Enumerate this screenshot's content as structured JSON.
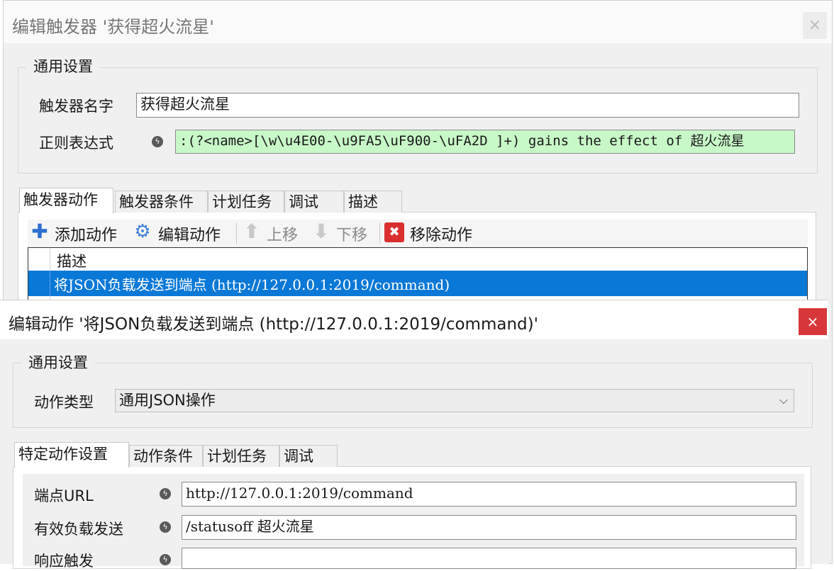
{
  "trigger_window": {
    "title": "编辑触发器 '获得超火流星'",
    "close_glyph": "×",
    "general_group": "通用设置",
    "name_label": "触发器名字",
    "name_value": "获得超火流星",
    "regex_label": "正则表达式",
    "regex_value": ":(?<name>[\\w\\u4E00-\\u9FA5\\uF900-\\uFA2D ]+) gains the effect of 超火流星",
    "tabs": [
      "触发器动作",
      "触发器条件",
      "计划任务",
      "调试",
      "描述"
    ],
    "toolbar": {
      "add": "添加动作",
      "edit": "编辑动作",
      "up": "上移",
      "down": "下移",
      "remove": "移除动作"
    },
    "list_header": "描述",
    "list_rows": [
      "将JSON负载发送到端点 (http://127.0.0.1:2019/command)"
    ]
  },
  "action_window": {
    "title": "编辑动作 '将JSON负载发送到端点 (http://127.0.0.1:2019/command)'",
    "close_glyph": "×",
    "general_group": "通用设置",
    "type_label": "动作类型",
    "type_value": "通用JSON操作",
    "tabs": [
      "特定动作设置",
      "动作条件",
      "计划任务",
      "调试"
    ],
    "endpoint_label": "端点URL",
    "endpoint_value": "http://127.0.0.1:2019/command",
    "payload_label": "有效负载发送",
    "payload_value": "/statusoff 超火流星",
    "response_label": "响应触发",
    "response_value": ""
  },
  "colors": {
    "selection": "#0a78d7",
    "regex_bg": "#c8f7c8",
    "close_red": "#d7373b"
  }
}
